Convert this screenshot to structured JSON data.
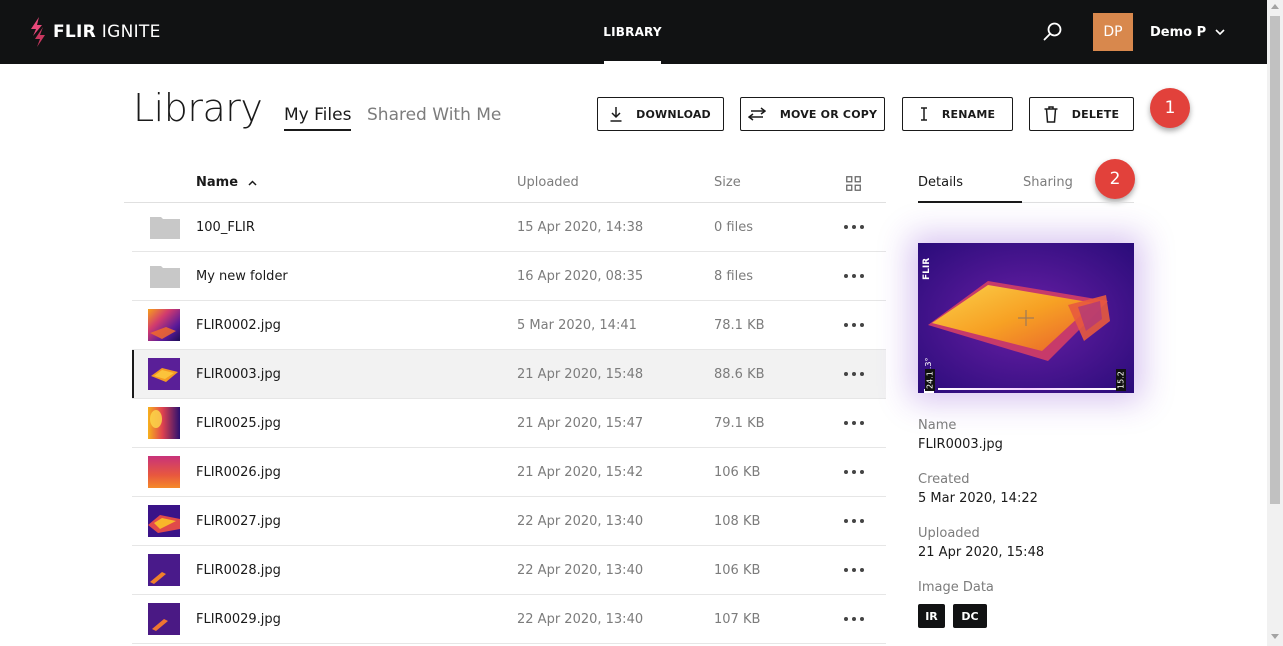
{
  "topbar": {
    "brand_bold": "FLIR",
    "brand_light": "IGNITE",
    "nav_library": "LIBRARY",
    "search_icon": "search-icon",
    "avatar_initials": "DP",
    "user_name": "Demo P",
    "colors": {
      "bar": "#111213",
      "avatar": "#d8884d"
    }
  },
  "page": {
    "title": "Library",
    "tabs": [
      {
        "label": "My Files",
        "active": true
      },
      {
        "label": "Shared With Me",
        "active": false
      }
    ]
  },
  "actions": {
    "download": "DOWNLOAD",
    "move_or_copy": "MOVE OR COPY",
    "rename": "RENAME",
    "delete": "DELETE"
  },
  "badges": {
    "first": "1",
    "second": "2",
    "color": "#e2413b"
  },
  "table": {
    "columns": {
      "name": "Name",
      "uploaded": "Uploaded",
      "size": "Size"
    },
    "sort": {
      "column": "Name",
      "direction": "ascending"
    },
    "rows": [
      {
        "type": "folder",
        "name": "100_FLIR",
        "uploaded": "15 Apr 2020, 14:38",
        "size": "0 files"
      },
      {
        "type": "folder",
        "name": "My new folder",
        "uploaded": "16 Apr 2020, 08:35",
        "size": "8 files"
      },
      {
        "type": "image",
        "name": "FLIR0002.jpg",
        "uploaded": "5 Mar 2020, 14:41",
        "size": "78.1 KB"
      },
      {
        "type": "image",
        "name": "FLIR0003.jpg",
        "uploaded": "21 Apr 2020, 15:48",
        "size": "88.6 KB",
        "selected": true
      },
      {
        "type": "image",
        "name": "FLIR0025.jpg",
        "uploaded": "21 Apr 2020, 15:47",
        "size": "79.1 KB"
      },
      {
        "type": "image",
        "name": "FLIR0026.jpg",
        "uploaded": "21 Apr 2020, 15:42",
        "size": "106 KB"
      },
      {
        "type": "image",
        "name": "FLIR0027.jpg",
        "uploaded": "22 Apr 2020, 13:40",
        "size": "108 KB"
      },
      {
        "type": "image",
        "name": "FLIR0028.jpg",
        "uploaded": "22 Apr 2020, 13:40",
        "size": "106 KB"
      },
      {
        "type": "image",
        "name": "FLIR0029.jpg",
        "uploaded": "22 Apr 2020, 13:40",
        "size": "107 KB"
      }
    ]
  },
  "details": {
    "tabs": [
      {
        "label": "Details",
        "active": true
      },
      {
        "label": "Sharing",
        "active": false
      }
    ],
    "preview": {
      "logo": "FLIR",
      "spot_temp": "∅․21.3°",
      "scale_min": "24.1",
      "scale_max": "15.2"
    },
    "fields": [
      {
        "label": "Name",
        "value": "FLIR0003.jpg"
      },
      {
        "label": "Created",
        "value": "5 Mar 2020, 14:22"
      },
      {
        "label": "Uploaded",
        "value": "21 Apr 2020, 15:48"
      }
    ],
    "image_data_label": "Image Data",
    "image_data_chips": [
      "IR",
      "DC"
    ]
  }
}
